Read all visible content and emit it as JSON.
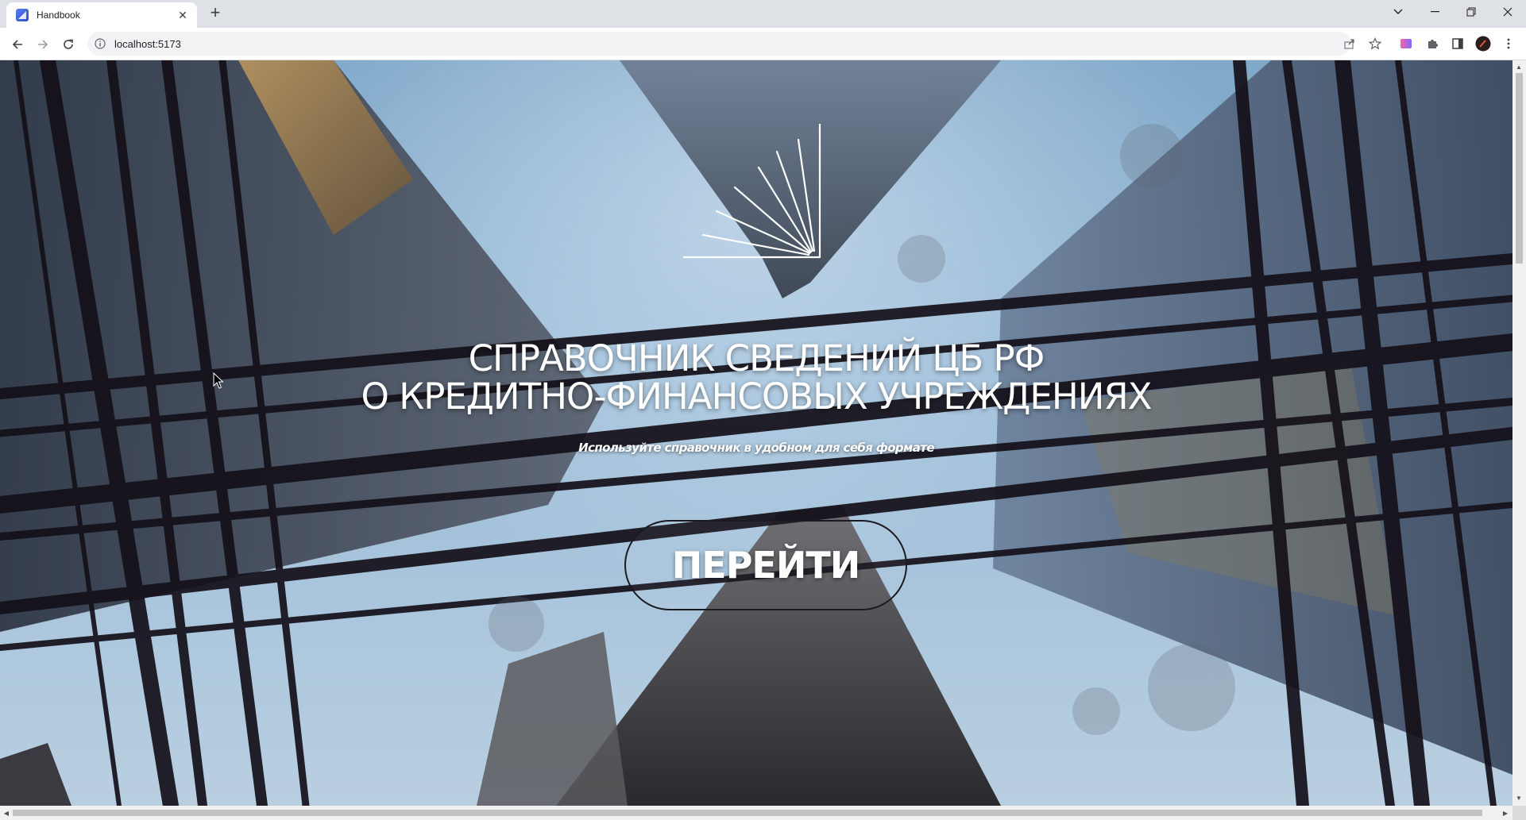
{
  "browser": {
    "tab": {
      "title": "Handbook",
      "close_icon": "close-icon"
    },
    "new_tab_icon": "plus-icon",
    "window_controls": {
      "tab_search_icon": "chevron-down-icon",
      "minimize_icon": "minimize-icon",
      "restore_icon": "restore-icon",
      "close_icon": "close-icon"
    },
    "nav": {
      "back_icon": "arrow-left-icon",
      "forward_icon": "arrow-right-icon",
      "reload_icon": "reload-icon"
    },
    "address_bar": {
      "info_icon": "info-icon",
      "url": "localhost:5173",
      "share_icon": "share-icon",
      "bookmark_icon": "star-icon"
    },
    "extensions": [
      "gradient-extension-icon",
      "puzzle-icon",
      "side-panel-icon",
      "profile-avatar",
      "kebab-menu-icon"
    ]
  },
  "page": {
    "logo_icon": "sunburst-logo-icon",
    "title_line1": "СПРАВОЧНИК СВЕДЕНИЙ ЦБ РФ",
    "title_line2": "О КРЕДИТНО-ФИНАНСОВЫХ УЧРЕЖДЕНИЯХ",
    "subtitle": "Используйте справочник в удобном для себя формате",
    "cta_label": "ПЕРЕЙТИ",
    "colors": {
      "text": "#ffffff",
      "cta_border": "#1a1a20",
      "sky": "#93b7d4"
    }
  }
}
